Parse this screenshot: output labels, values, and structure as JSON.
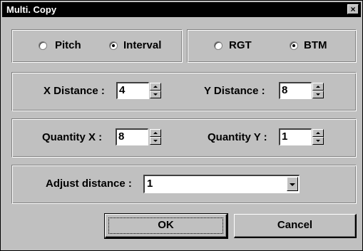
{
  "window": {
    "title": "Multi. Copy",
    "close_glyph": "×"
  },
  "mode_group": {
    "options": [
      {
        "label": "Pitch",
        "checked": false
      },
      {
        "label": "Interval",
        "checked": true
      }
    ]
  },
  "direction_group": {
    "options": [
      {
        "label": "RGT",
        "checked": false
      },
      {
        "label": "BTM",
        "checked": true
      }
    ]
  },
  "distance_group": {
    "x_label": "X Distance :",
    "x_value": "4",
    "y_label": "Y Distance :",
    "y_value": "8"
  },
  "quantity_group": {
    "x_label": "Quantity X :",
    "x_value": "8",
    "y_label": "Quantity Y :",
    "y_value": "1"
  },
  "adjust_group": {
    "label": "Adjust distance :",
    "value": "1"
  },
  "buttons": {
    "ok": "OK",
    "cancel": "Cancel"
  },
  "colors": {
    "face": "#c0c0c0",
    "titlebar": "#000000",
    "title_text": "#ffffff"
  }
}
